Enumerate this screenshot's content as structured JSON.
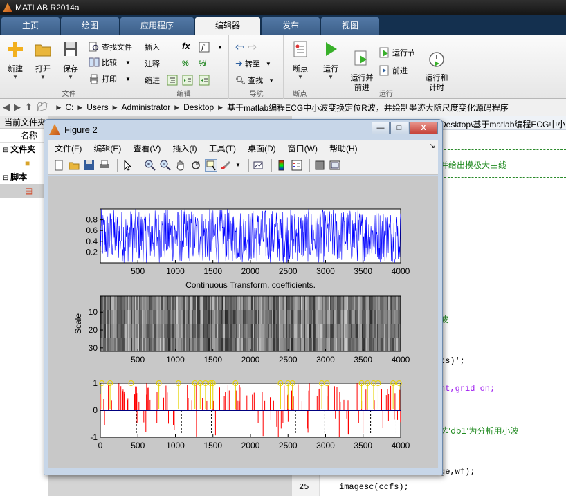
{
  "app": {
    "title": "MATLAB R2014a"
  },
  "ribbon_tabs": [
    "主页",
    "绘图",
    "应用程序",
    "编辑器",
    "发布",
    "视图"
  ],
  "ribbon": {
    "file_group": {
      "label": "文件",
      "new": "新建",
      "open": "打开",
      "save": "保存",
      "find_files": "查找文件",
      "compare": "比较",
      "print": "打印"
    },
    "edit_group": {
      "label": "编辑",
      "insert": "插入",
      "comment": "注释",
      "indent": "缩进",
      "fx_symbol": "fx"
    },
    "nav_group": {
      "label": "导航",
      "goto": "转至",
      "find": "查找"
    },
    "breakpoints_group": {
      "label": "断点",
      "breakpoints": "断点"
    },
    "run_group": {
      "label": "运行",
      "run": "运行",
      "run_advance": "运行并\n前进",
      "run_section": "运行节",
      "advance": "前进",
      "run_time": "运行和\n计时"
    }
  },
  "address": {
    "segments": [
      "C:",
      "Users",
      "Administrator",
      "Desktop",
      "基于matlab编程ECG中小波变换定位R波，并绘制墨迹大随尺度变化源码程序"
    ]
  },
  "left_panel": {
    "header": "当前文件夹",
    "column": "名称",
    "folder_section": "文件夹",
    "script_section": "脚本"
  },
  "editor": {
    "path_fragment": "Desktop\\基于matlab编程ECG中小",
    "comment_line": "并给出模极大曲线",
    "frag_1": "波",
    "frag_2": "ts)';",
    "frag_3_a": "ht,grid ",
    "frag_3_b": "on;",
    "frag_4": "选'db1'为分析用小波",
    "frag_5": "ge,wf);",
    "line_25_number": "25",
    "line_25_code": "imagesc(ccfs);"
  },
  "figure": {
    "title": "Figure 2",
    "menu": [
      "文件(F)",
      "编辑(E)",
      "查看(V)",
      "插入(I)",
      "工具(T)",
      "桌面(D)",
      "窗口(W)",
      "帮助(H)"
    ],
    "win_buttons": {
      "min": "—",
      "max": "□",
      "close": "X"
    }
  },
  "chart_data": [
    {
      "type": "line",
      "title": "",
      "xlabel": "",
      "ylabel": "",
      "xlim": [
        1,
        4000
      ],
      "ylim": [
        0,
        1
      ],
      "xticks": [
        500,
        1000,
        1500,
        2000,
        2500,
        3000,
        3500,
        4000
      ],
      "yticks": [
        0.2,
        0.4,
        0.6,
        0.8
      ],
      "series": [
        {
          "color": "#0000ff",
          "description_range": [
            0.0,
            1.0
          ]
        }
      ]
    },
    {
      "type": "heatmap",
      "title": "Continuous Transform, coefficients.",
      "xlabel": "",
      "ylabel": "Scale",
      "xlim": [
        1,
        4000
      ],
      "ylim": [
        1,
        32
      ],
      "xticks": [
        500,
        1000,
        1500,
        2000,
        2500,
        3000,
        3500,
        4000
      ],
      "yticks": [
        10,
        20,
        30
      ],
      "colormap": "gray"
    },
    {
      "type": "line",
      "title": "",
      "xlabel": "",
      "ylabel": "",
      "xlim": [
        0,
        4000
      ],
      "ylim": [
        -1,
        1
      ],
      "xticks": [
        0,
        500,
        1000,
        1500,
        2000,
        2500,
        3000,
        3500,
        4000
      ],
      "yticks": [
        -1,
        0,
        1
      ],
      "series_colors": {
        "modulus_maxima": "#ff0000",
        "r_peaks": "#e6d200",
        "baseline": "#00007f",
        "dashed": "#000000"
      },
      "r_peak_markers_x": [
        20,
        130,
        410,
        780,
        1040,
        1260,
        1330,
        1400,
        1470,
        1500,
        1800,
        2400,
        2500,
        2560,
        2950,
        3020,
        3480,
        3560,
        3640,
        3700,
        3900,
        3980
      ],
      "dashed_x": [
        480,
        1080,
        1480,
        2600,
        2990,
        3600,
        3940
      ]
    }
  ]
}
